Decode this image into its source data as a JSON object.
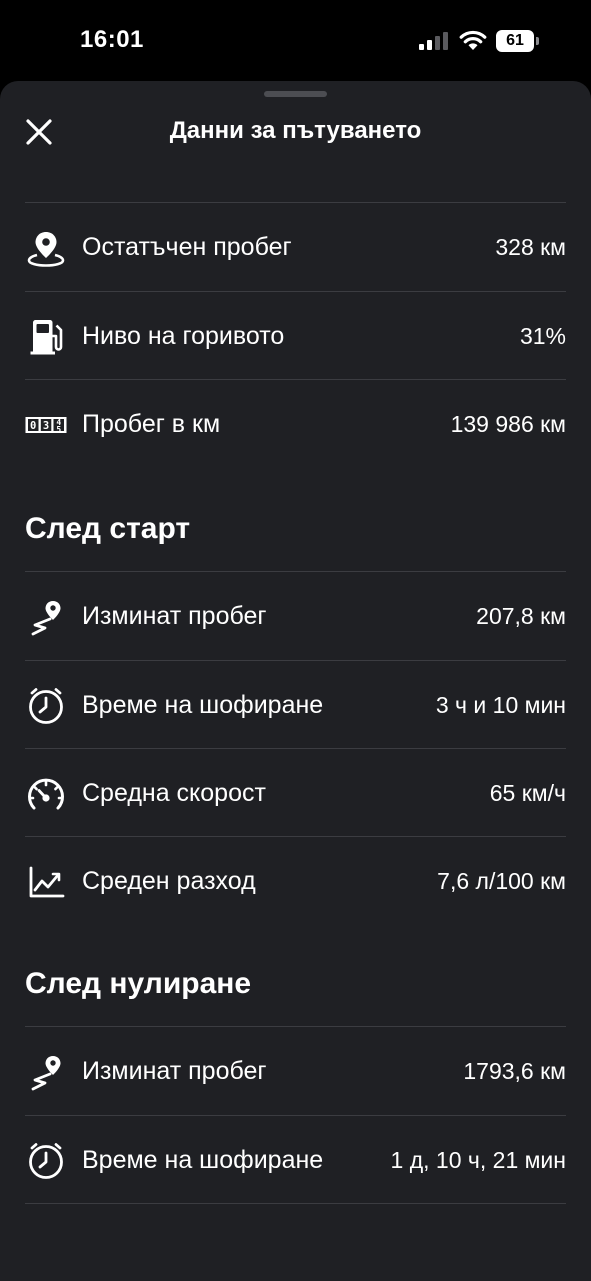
{
  "status_bar": {
    "time": "16:01",
    "battery": "61"
  },
  "sheet": {
    "title": "Данни за пътуването"
  },
  "overview": [
    {
      "icon": "location-pin-icon",
      "label": "Остатъчен пробег",
      "value": "328 км"
    },
    {
      "icon": "fuel-pump-icon",
      "label": "Ниво на горивото",
      "value": "31%"
    },
    {
      "icon": "odometer-icon",
      "label": "Пробег в км",
      "value": "139 986 км"
    }
  ],
  "since_start": {
    "title": "След старт",
    "rows": [
      {
        "icon": "route-pin-icon",
        "label": "Изминат пробег",
        "value": "207,8 км"
      },
      {
        "icon": "clock-icon",
        "label": "Време на шофиране",
        "value": "3 ч и 10 мин"
      },
      {
        "icon": "speedometer-icon",
        "label": "Средна скорост",
        "value": "65 км/ч"
      },
      {
        "icon": "consumption-chart-icon",
        "label": "Среден разход",
        "value": "7,6 л/100 км"
      }
    ]
  },
  "since_reset": {
    "title": "След нулиране",
    "rows": [
      {
        "icon": "route-pin-icon",
        "label": "Изминат пробег",
        "value": "1793,6 км"
      },
      {
        "icon": "clock-icon",
        "label": "Време на шофиране",
        "value": "1 д, 10 ч, 21 мин"
      }
    ]
  }
}
